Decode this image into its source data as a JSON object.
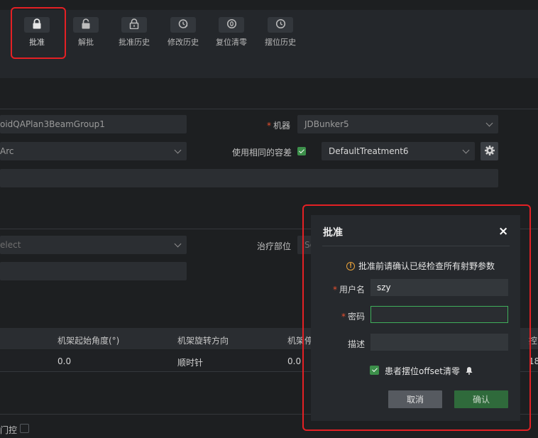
{
  "toolbar": {
    "items": [
      {
        "label": "批准",
        "icon": "lock-icon"
      },
      {
        "label": "解批",
        "icon": "unlock-icon"
      },
      {
        "label": "批准历史",
        "icon": "lock-history-icon"
      },
      {
        "label": "修改历史",
        "icon": "edit-history-icon"
      },
      {
        "label": "复位清零",
        "icon": "reset-zero-icon"
      },
      {
        "label": "摆位历史",
        "icon": "clock-icon"
      }
    ]
  },
  "form": {
    "plan_name_value": "oidQAPlan3BeamGroup1",
    "machine_label": "机器",
    "machine_value": "JDBunker5",
    "technique_value": "Arc",
    "same_tolerance_label": "使用相同的容差",
    "tolerance_value": "DefaultTreatment6",
    "site_select_placeholder": "elect",
    "treatment_site_label": "治疗部位",
    "treatment_site_value": "Se"
  },
  "table": {
    "headers": [
      "机架起始角度(°)",
      "机架旋转方向",
      "机架停",
      "控"
    ],
    "rows": [
      [
        "0.0",
        "顺时针",
        "0.0",
        "18"
      ]
    ]
  },
  "footer": {
    "gating_label": "门控"
  },
  "dialog": {
    "title": "批准",
    "close": "×",
    "warning": "批准前请确认已经检查所有射野参数",
    "username_label": "用户名",
    "username_value": "szy",
    "password_label": "密码",
    "password_value": "",
    "description_label": "描述",
    "description_value": "",
    "reset_offset_label": "患者摆位offset清零",
    "cancel_label": "取消",
    "confirm_label": "确认"
  },
  "colors": {
    "accent_green": "#3c8f4a",
    "highlight_red": "#e42024",
    "warning": "#e8a23a"
  }
}
